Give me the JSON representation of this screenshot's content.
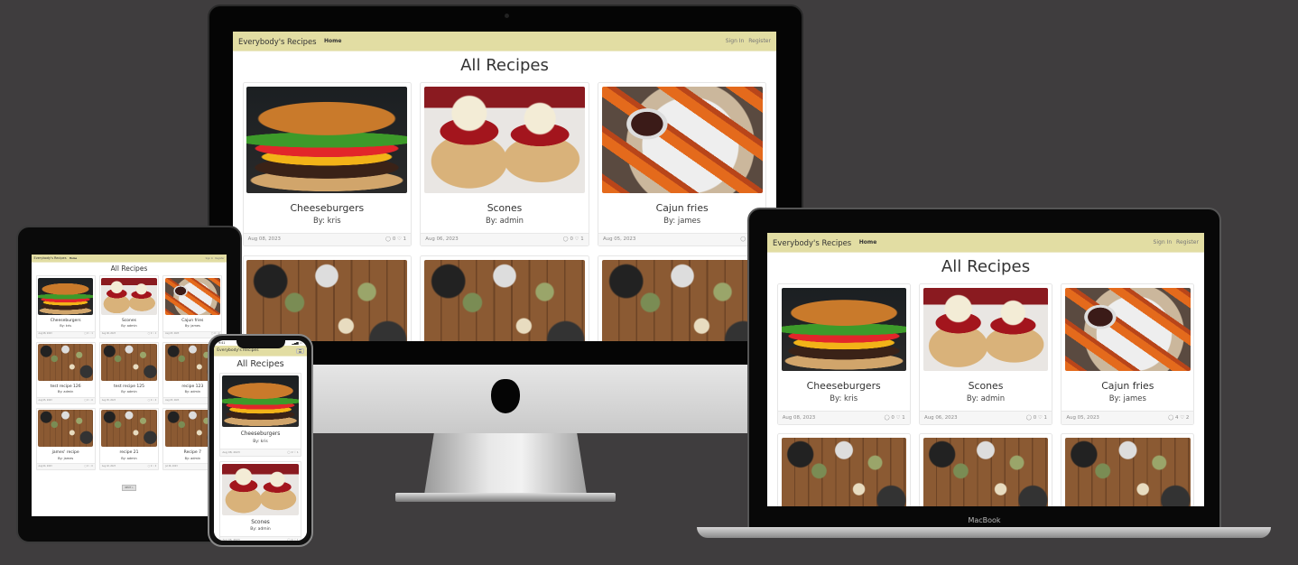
{
  "site": {
    "brand": "Everybody's Recipes",
    "nav_home": "Home",
    "nav_sign_in": "Sign In",
    "nav_register": "Register",
    "page_title": "All Recipes",
    "pager_next": "NEXT »",
    "recipes": [
      {
        "title": "Cheeseburgers",
        "author": "By: kris",
        "date": "Aug 08, 2023",
        "comments": "0",
        "likes": "1",
        "image": "burger"
      },
      {
        "title": "Scones",
        "author": "By: admin",
        "date": "Aug 06, 2023",
        "comments": "0",
        "likes": "1",
        "image": "scones"
      },
      {
        "title": "Cajun fries",
        "author": "By: james",
        "date": "Aug 05, 2023",
        "comments": "4",
        "likes": "2",
        "image": "fries"
      },
      {
        "title": "test recipe 126",
        "author": "By: admin",
        "date": "Aug 05, 2023",
        "comments": "0",
        "likes": "0",
        "image": "table"
      },
      {
        "title": "test recipe 125",
        "author": "By: admin",
        "date": "Aug 05, 2023",
        "comments": "0",
        "likes": "0",
        "image": "table"
      },
      {
        "title": "recipe 123",
        "author": "By: admin",
        "date": "Aug 05, 2023",
        "comments": "0",
        "likes": "0",
        "image": "table"
      },
      {
        "title": "james' recipe",
        "author": "By: james",
        "date": "Aug 04, 2023",
        "comments": "0",
        "likes": "0",
        "image": "table"
      },
      {
        "title": "recipe 21",
        "author": "By: admin",
        "date": "Aug 02, 2023",
        "comments": "0",
        "likes": "0",
        "image": "table"
      },
      {
        "title": "Recipe 7",
        "author": "By: admin",
        "date": "Jul 26, 2023",
        "comments": "",
        "likes": "",
        "image": "table"
      }
    ]
  },
  "devices": {
    "laptop_label": "MacBook",
    "phone_time": "9:41"
  },
  "colors": {
    "background": "#3f3d3e",
    "navbar": "#e2dda3"
  }
}
